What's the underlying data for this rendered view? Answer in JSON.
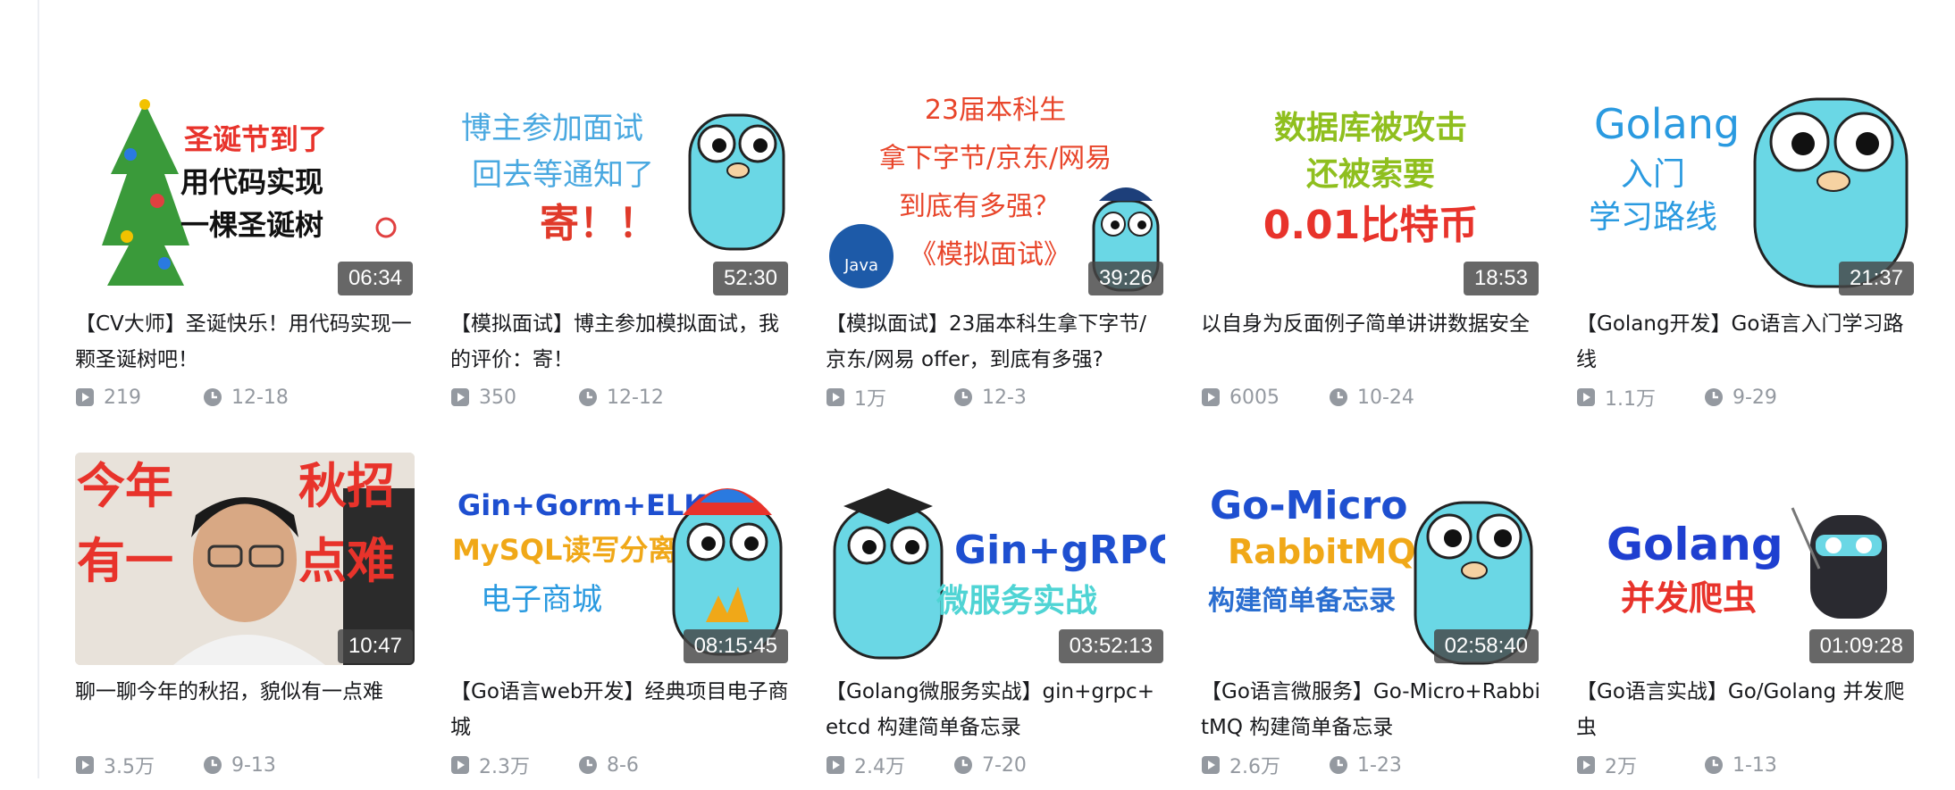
{
  "videos": [
    {
      "title": "【CV大师】圣诞快乐！用代码实现一颗圣诞树吧！",
      "duration": "06:34",
      "plays": "219",
      "date": "12-18",
      "thumb_text": [
        "圣诞节到了",
        "用代码实现",
        "一棵圣诞树"
      ]
    },
    {
      "title": "【模拟面试】博主参加模拟面试，我的评价：寄！",
      "duration": "52:30",
      "plays": "350",
      "date": "12-12",
      "thumb_text": [
        "博主参加面试",
        "回去等通知了",
        "寄！！"
      ]
    },
    {
      "title": "【模拟面试】23届本科生拿下字节/京东/网易 offer，到底有多强?",
      "duration": "39:26",
      "plays": "1万",
      "date": "12-3",
      "thumb_text": [
        "23届本科生",
        "拿下字节/京东/网易",
        "到底有多强？",
        "《模拟面试》",
        "Java"
      ]
    },
    {
      "title": "以自身为反面例子简单讲讲数据安全",
      "duration": "18:53",
      "plays": "6005",
      "date": "10-24",
      "thumb_text": [
        "数据库被攻击",
        "还被索要",
        "0.01比特币"
      ]
    },
    {
      "title": "【Golang开发】Go语言入门学习路线",
      "duration": "21:37",
      "plays": "1.1万",
      "date": "9-29",
      "thumb_text": [
        "Golang",
        "入门",
        "学习路线"
      ]
    },
    {
      "title": "聊一聊今年的秋招，貌似有一点难",
      "duration": "10:47",
      "plays": "3.5万",
      "date": "9-13",
      "thumb_text": [
        "今年",
        "秋招",
        "有一",
        "点难"
      ]
    },
    {
      "title": "【Go语言web开发】经典项目电子商城",
      "duration": "08:15:45",
      "plays": "2.3万",
      "date": "8-6",
      "thumb_text": [
        "Gin+Gorm+ELK",
        "MySQL读写分离",
        "电子商城"
      ]
    },
    {
      "title": "【Golang微服务实战】gin+grpc+etcd 构建简单备忘录",
      "duration": "03:52:13",
      "plays": "2.4万",
      "date": "7-20",
      "thumb_text": [
        "Gin+gRPC",
        "微服务实战"
      ]
    },
    {
      "title": "【Go语言微服务】Go-Micro+RabbitMQ 构建简单备忘录",
      "duration": "02:58:40",
      "plays": "2.6万",
      "date": "1-23",
      "thumb_text": [
        "Go-Micro",
        "RabbitMQ",
        "构建简单备忘录"
      ]
    },
    {
      "title": "【Go语言实战】Go/Golang 并发爬虫",
      "duration": "01:09:28",
      "plays": "2万",
      "date": "1-13",
      "thumb_text": [
        "Golang",
        "并发爬虫"
      ]
    }
  ],
  "icons": {
    "plays": "play-count-icon",
    "date": "clock-icon"
  },
  "colors": {
    "gopher": "#6ad7e5",
    "meta": "#9499a0",
    "title": "#18191c"
  }
}
